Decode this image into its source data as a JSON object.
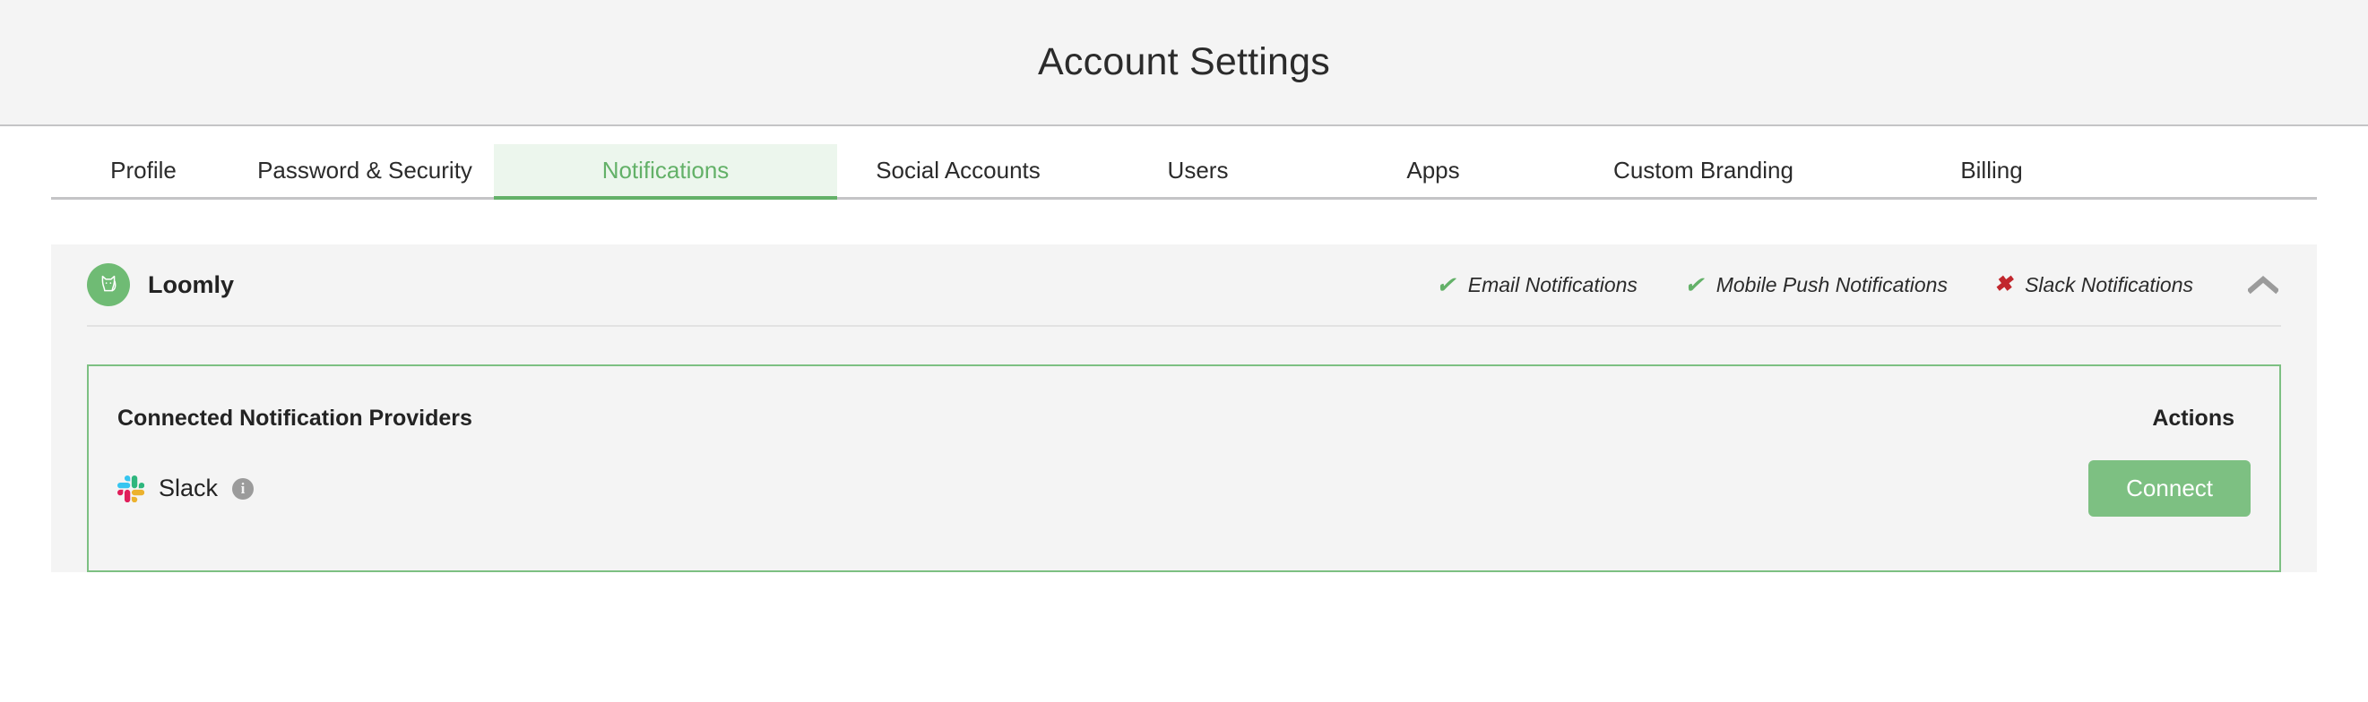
{
  "header": {
    "title": "Account Settings"
  },
  "tabs": [
    {
      "label": "Profile",
      "active": false
    },
    {
      "label": "Password & Security",
      "active": false
    },
    {
      "label": "Notifications",
      "active": true
    },
    {
      "label": "Social Accounts",
      "active": false
    },
    {
      "label": "Users",
      "active": false
    },
    {
      "label": "Apps",
      "active": false
    },
    {
      "label": "Custom Branding",
      "active": false
    },
    {
      "label": "Billing",
      "active": false
    }
  ],
  "card": {
    "brand": {
      "name": "Loomly",
      "logo_icon": "loomly-cat-icon"
    },
    "statuses": [
      {
        "label": "Email Notifications",
        "state": "enabled",
        "icon": "check-icon",
        "glyph": "✔"
      },
      {
        "label": "Mobile Push Notifications",
        "state": "enabled",
        "icon": "check-icon",
        "glyph": "✔"
      },
      {
        "label": "Slack Notifications",
        "state": "disabled",
        "icon": "cross-icon",
        "glyph": "✖"
      }
    ],
    "collapse_icon": "chevron-up-icon",
    "panel": {
      "title": "Connected Notification Providers",
      "actions_header": "Actions",
      "providers": [
        {
          "name": "Slack",
          "logo_icon": "slack-icon",
          "info_icon": "info-icon",
          "info_glyph": "i",
          "action_label": "Connect"
        }
      ]
    }
  },
  "colors": {
    "accent_green": "#7dc082",
    "tab_active_green": "#63b168",
    "tab_active_bg": "#ecf6ed",
    "error_red": "#c1272d",
    "card_bg": "#f4f4f4",
    "header_bg": "#f4f4f4"
  }
}
